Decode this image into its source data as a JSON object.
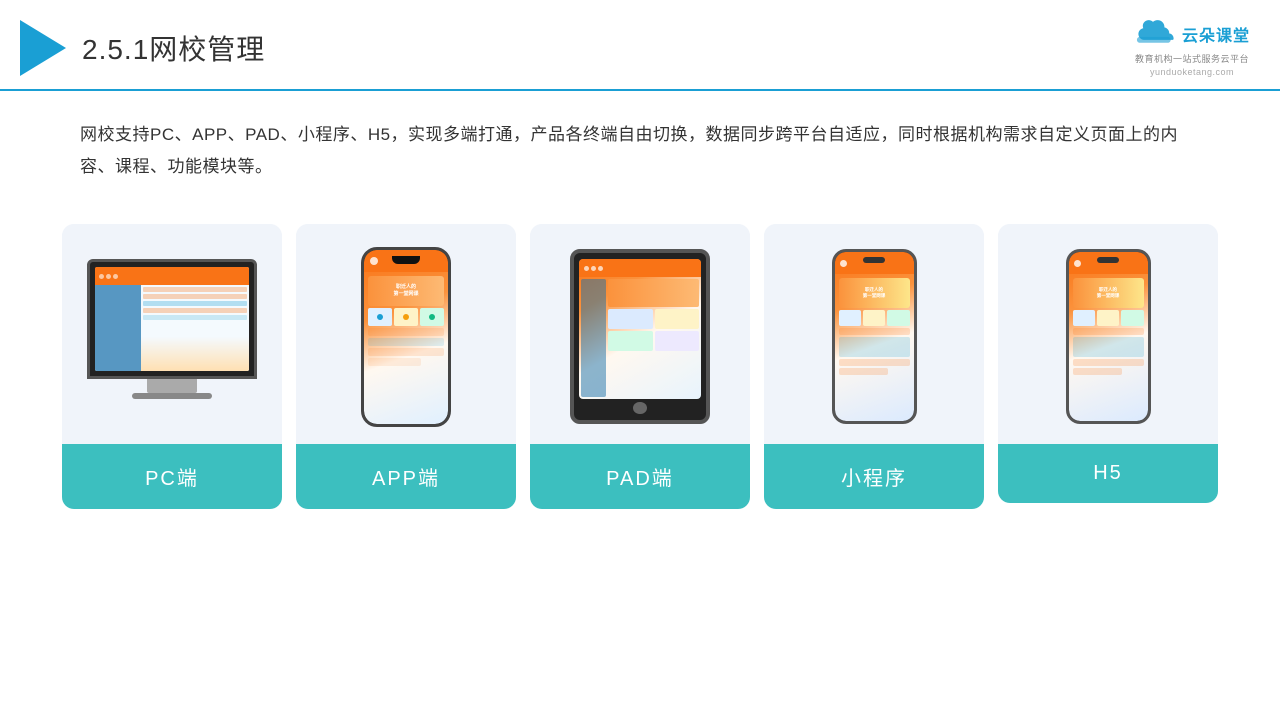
{
  "header": {
    "title_prefix": "2.5.1",
    "title_main": "网校管理"
  },
  "logo": {
    "brand": "云朵课堂",
    "tagline": "教育机构一站\n式服务云平台",
    "domain": "yunduoketang.com"
  },
  "description": "网校支持PC、APP、PAD、小程序、H5，实现多端打通，产品各终端自由切换，数据同步跨平台自适应，同时根据机构需求自定义页面上的内容、课程、功能模块等。",
  "cards": [
    {
      "id": "pc",
      "label": "PC端"
    },
    {
      "id": "app",
      "label": "APP端"
    },
    {
      "id": "pad",
      "label": "PAD端"
    },
    {
      "id": "miniprogram",
      "label": "小程序"
    },
    {
      "id": "h5",
      "label": "H5"
    }
  ]
}
